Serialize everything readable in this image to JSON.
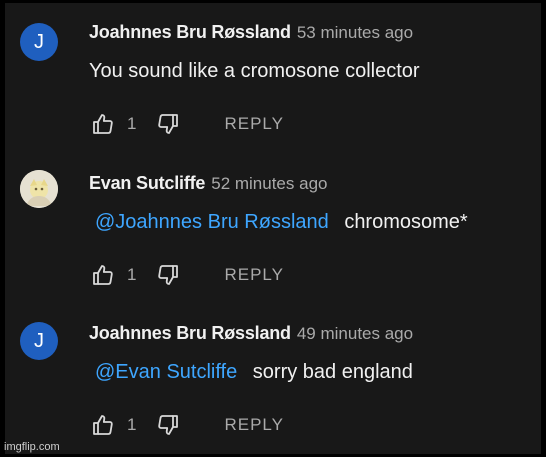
{
  "comments": [
    {
      "avatar_letter": "J",
      "avatar_type": "letter",
      "author": "Joahnnes Bru Røssland",
      "time": "53 minutes ago",
      "mention": "",
      "text": "You sound like a cromosone collector",
      "likes": "1",
      "reply_label": "REPLY"
    },
    {
      "avatar_letter": "",
      "avatar_type": "photo",
      "author": "Evan Sutcliffe",
      "time": "52 minutes ago",
      "mention": "@Joahnnes Bru Røssland",
      "text": "chromosome*",
      "likes": "1",
      "reply_label": "REPLY"
    },
    {
      "avatar_letter": "J",
      "avatar_type": "letter",
      "author": "Joahnnes Bru Røssland",
      "time": "49 minutes ago",
      "mention": "@Evan Sutcliffe",
      "text": "sorry bad england",
      "likes": "1",
      "reply_label": "REPLY"
    }
  ],
  "watermark": "imgflip.com",
  "colors": {
    "background": "#181818",
    "avatar_blue": "#1f5fbf",
    "mention": "#3ea6ff",
    "muted": "#aaaaaa"
  },
  "icons": [
    "thumbs-up-icon",
    "thumbs-down-icon"
  ]
}
